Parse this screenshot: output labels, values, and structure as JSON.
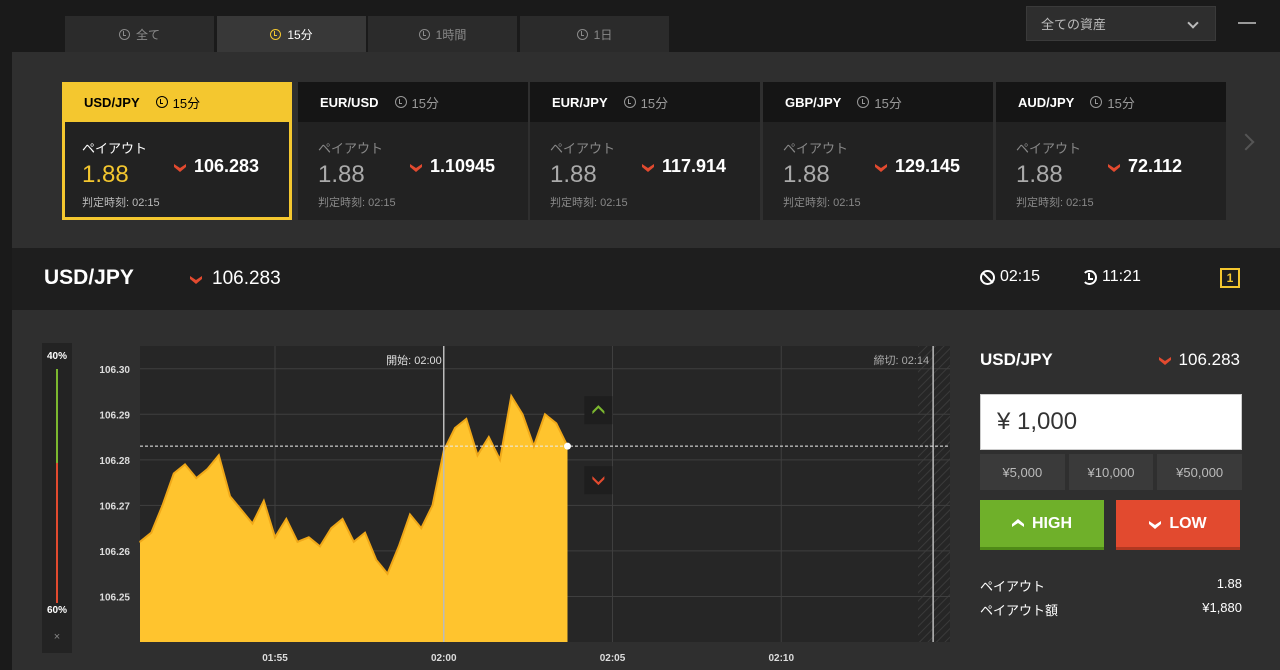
{
  "tabs": [
    {
      "label": "全て",
      "active": false
    },
    {
      "label": "15分",
      "active": true
    },
    {
      "label": "1時間",
      "active": false
    },
    {
      "label": "1日",
      "active": false
    }
  ],
  "asset_filter": {
    "selected": "全ての資産"
  },
  "cards": [
    {
      "pair": "USD/JPY",
      "period": "15分",
      "payout_label": "ペイアウト",
      "payout": "1.88",
      "rate": "106.283",
      "judge": "判定時刻: 02:15",
      "active": true
    },
    {
      "pair": "EUR/USD",
      "period": "15分",
      "payout_label": "ペイアウト",
      "payout": "1.88",
      "rate": "1.10945",
      "judge": "判定時刻: 02:15",
      "active": false
    },
    {
      "pair": "EUR/JPY",
      "period": "15分",
      "payout_label": "ペイアウト",
      "payout": "1.88",
      "rate": "117.914",
      "judge": "判定時刻: 02:15",
      "active": false
    },
    {
      "pair": "GBP/JPY",
      "period": "15分",
      "payout_label": "ペイアウト",
      "payout": "1.88",
      "rate": "129.145",
      "judge": "判定時刻: 02:15",
      "active": false
    },
    {
      "pair": "AUD/JPY",
      "period": "15分",
      "payout_label": "ペイアウト",
      "payout": "1.88",
      "rate": "72.112",
      "judge": "判定時刻: 02:15",
      "active": false
    }
  ],
  "header": {
    "pair": "USD/JPY",
    "rate": "106.283",
    "expiry": "02:15",
    "remaining": "11:21",
    "oneclick": "1"
  },
  "ratio": {
    "high": "40%",
    "low": "60%",
    "close": "×"
  },
  "chart": {
    "start_label": "開始: 02:00",
    "end_label": "締切: 02:14",
    "colors": {
      "area": "#ffc42e",
      "line": "#f0a818",
      "grid": "#3f3f3f"
    }
  },
  "chart_data": {
    "type": "area",
    "x_ticks": [
      "01:55",
      "02:00",
      "02:05",
      "02:10"
    ],
    "y_ticks": [
      106.3,
      106.29,
      106.28,
      106.27,
      106.26,
      106.25
    ],
    "ylim": [
      106.24,
      106.305
    ],
    "xlim": [
      "01:51",
      "02:15"
    ],
    "current": 106.283,
    "series": [
      {
        "values": [
          [
            "01:51:00",
            106.262
          ],
          [
            "01:51:20",
            106.264
          ],
          [
            "01:51:40",
            106.27
          ],
          [
            "01:52:00",
            106.277
          ],
          [
            "01:52:20",
            106.279
          ],
          [
            "01:52:40",
            106.276
          ],
          [
            "01:53:00",
            106.278
          ],
          [
            "01:53:20",
            106.281
          ],
          [
            "01:53:40",
            106.272
          ],
          [
            "01:54:00",
            106.269
          ],
          [
            "01:54:20",
            106.266
          ],
          [
            "01:54:40",
            106.271
          ],
          [
            "01:55:00",
            106.263
          ],
          [
            "01:55:20",
            106.267
          ],
          [
            "01:55:40",
            106.262
          ],
          [
            "01:56:00",
            106.263
          ],
          [
            "01:56:20",
            106.261
          ],
          [
            "01:56:40",
            106.265
          ],
          [
            "01:57:00",
            106.267
          ],
          [
            "01:57:20",
            106.262
          ],
          [
            "01:57:40",
            106.264
          ],
          [
            "01:58:00",
            106.258
          ],
          [
            "01:58:20",
            106.255
          ],
          [
            "01:58:40",
            106.261
          ],
          [
            "01:59:00",
            106.268
          ],
          [
            "01:59:20",
            106.265
          ],
          [
            "01:59:40",
            106.27
          ],
          [
            "02:00:00",
            106.282
          ],
          [
            "02:00:20",
            106.287
          ],
          [
            "02:00:40",
            106.289
          ],
          [
            "02:01:00",
            106.281
          ],
          [
            "02:01:20",
            106.285
          ],
          [
            "02:01:40",
            106.28
          ],
          [
            "02:02:00",
            106.294
          ],
          [
            "02:02:20",
            106.29
          ],
          [
            "02:02:40",
            106.283
          ],
          [
            "02:03:00",
            106.29
          ],
          [
            "02:03:20",
            106.288
          ],
          [
            "02:03:40",
            106.283
          ]
        ]
      }
    ]
  },
  "trade": {
    "pair": "USD/JPY",
    "rate": "106.283",
    "amount": "¥ 1,000",
    "presets": [
      "¥5,000",
      "¥10,000",
      "¥50,000"
    ],
    "high_label": "HIGH",
    "low_label": "LOW",
    "payout_label": "ペイアウト",
    "payout": "1.88",
    "payout_amount_label": "ペイアウト額",
    "payout_amount": "¥1,880"
  }
}
